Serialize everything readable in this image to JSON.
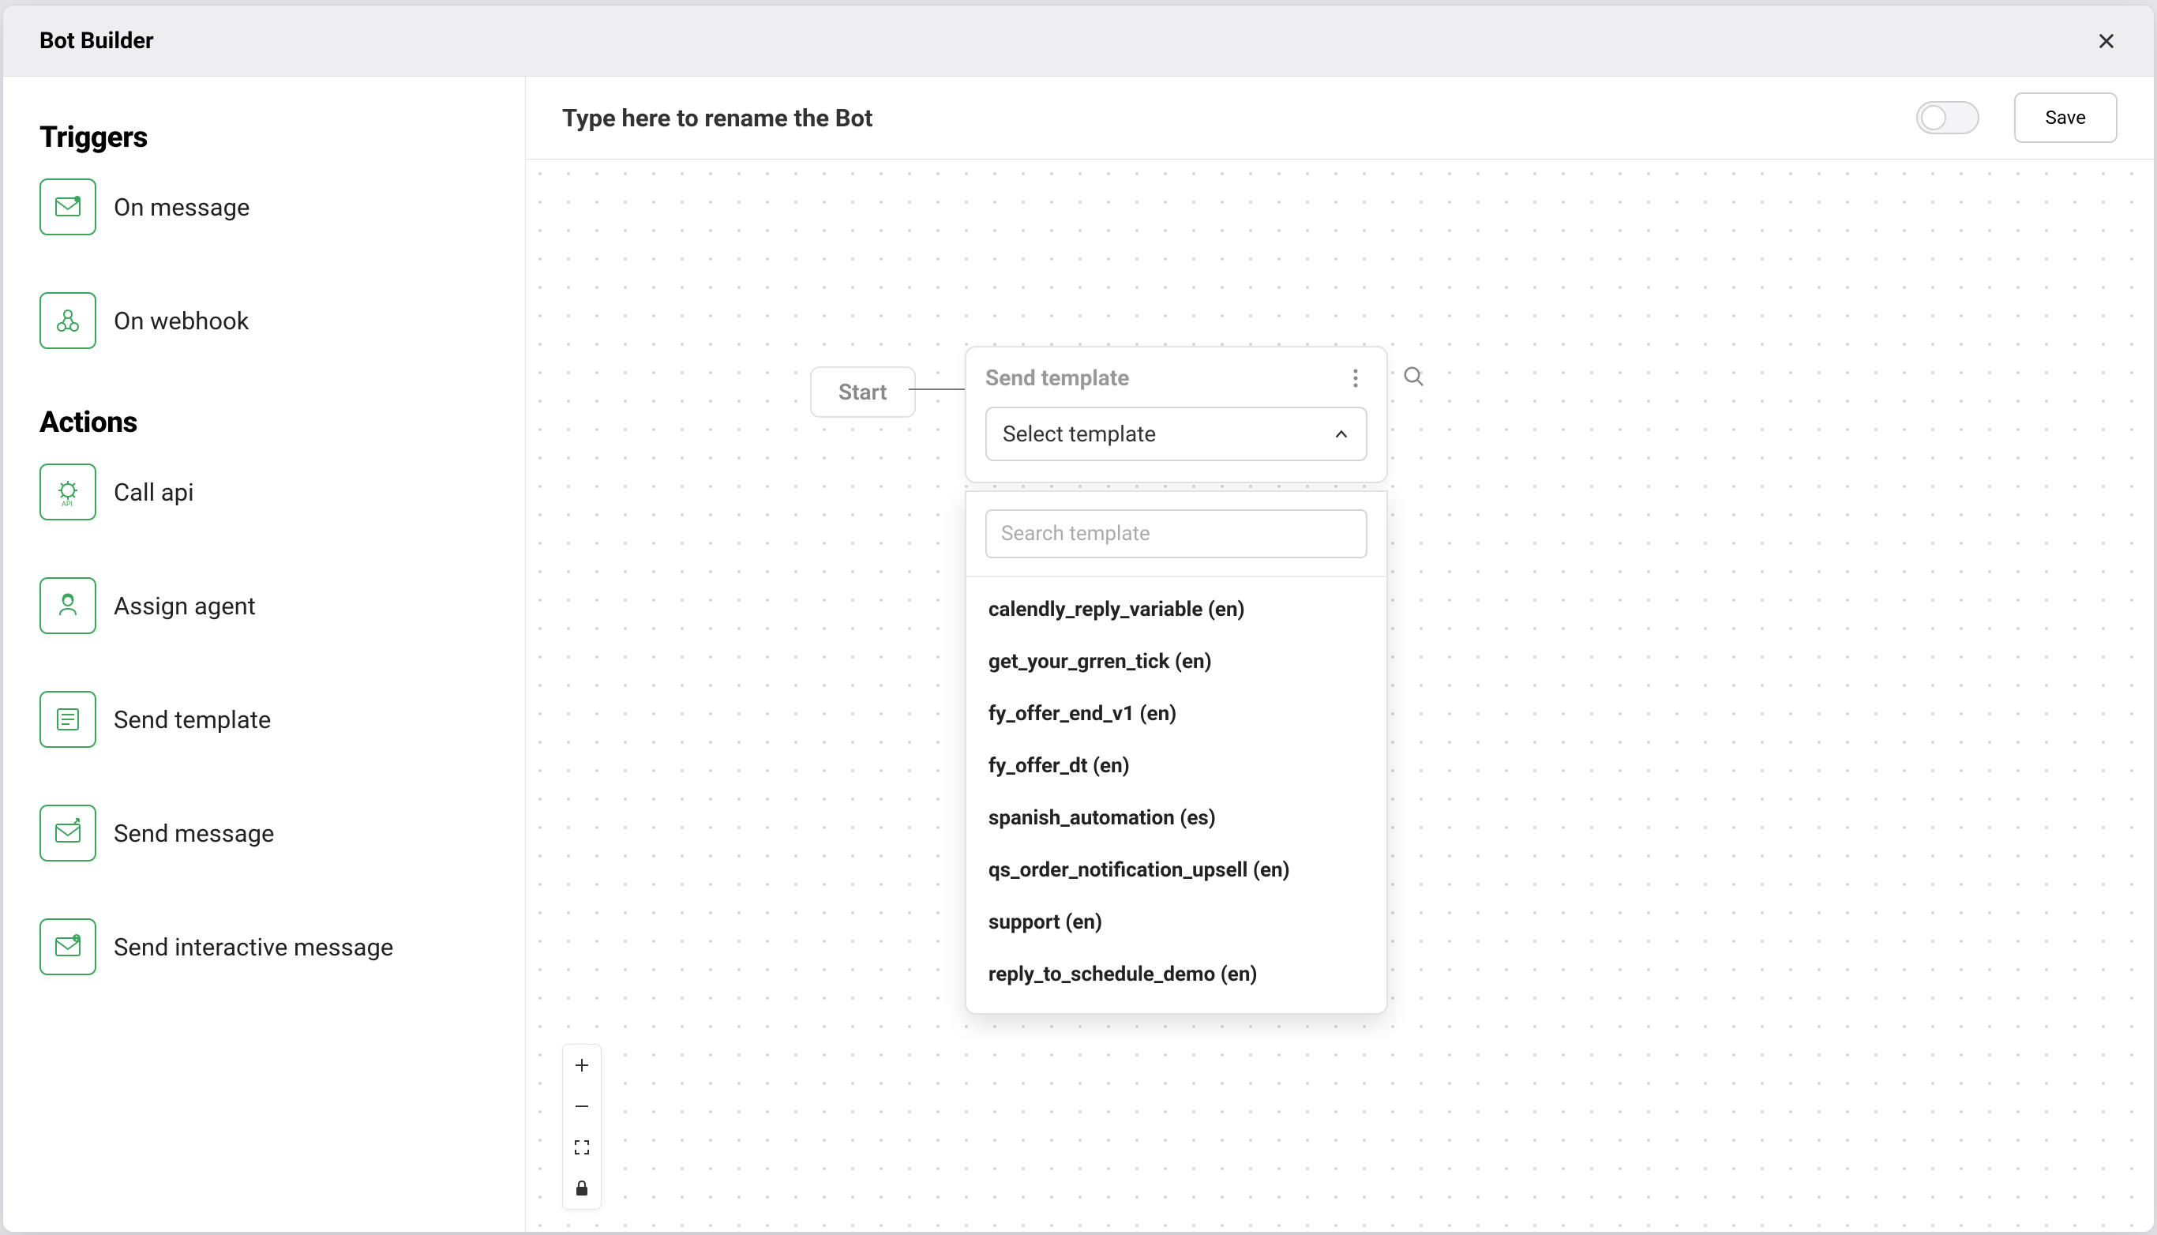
{
  "modal": {
    "title": "Bot Builder"
  },
  "sidebar": {
    "triggers_heading": "Triggers",
    "actions_heading": "Actions",
    "triggers": [
      {
        "label": "On message",
        "icon": "message-icon"
      },
      {
        "label": "On webhook",
        "icon": "webhook-icon"
      }
    ],
    "actions": [
      {
        "label": "Call api",
        "icon": "api-icon"
      },
      {
        "label": "Assign agent",
        "icon": "agent-icon"
      },
      {
        "label": "Send template",
        "icon": "template-icon"
      },
      {
        "label": "Send message",
        "icon": "send-message-icon"
      },
      {
        "label": "Send interactive message",
        "icon": "interactive-message-icon"
      }
    ]
  },
  "rename": {
    "placeholder": "Type here to rename the Bot",
    "value": ""
  },
  "toggle": {
    "enabled": false
  },
  "save_button": "Save",
  "canvas": {
    "start_label": "Start",
    "node": {
      "title": "Send template",
      "select_label": "Select template",
      "dropdown": {
        "search_placeholder": "Search template",
        "options": [
          "calendly_reply_variable (en)",
          "get_your_grren_tick (en)",
          "fy_offer_end_v1 (en)",
          "fy_offer_dt (en)",
          "spanish_automation (es)",
          "qs_order_notification_upsell (en)",
          "support (en)",
          "reply_to_schedule_demo (en)"
        ]
      }
    }
  }
}
